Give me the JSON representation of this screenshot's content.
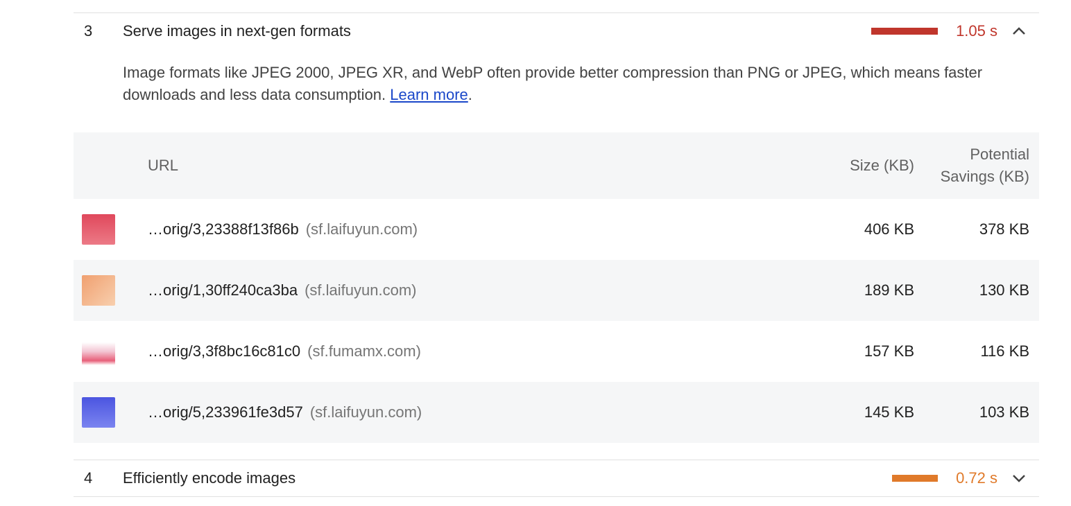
{
  "audits": [
    {
      "index": "3",
      "title": "Serve images in next-gen formats",
      "savings": "1.05 s",
      "savings_fraction": 1.0,
      "color": "#c0362c",
      "expanded": true,
      "description": "Image formats like JPEG 2000, JPEG XR, and WebP often provide better compression than PNG or JPEG, which means faster downloads and less data consumption.",
      "learn_more": "Learn more",
      "period": "."
    },
    {
      "index": "4",
      "title": "Efficiently encode images",
      "savings": "0.72 s",
      "savings_fraction": 0.69,
      "color": "#e07a2a",
      "expanded": false
    }
  ],
  "table": {
    "headers": {
      "url": "URL",
      "size": "Size (KB)",
      "savings_line1": "Potential",
      "savings_line2": "Savings (KB)"
    },
    "rows": [
      {
        "url": "…orig/3,23388f13f86b",
        "host": "(sf.laifuyun.com)",
        "size": "406 KB",
        "savings": "378 KB",
        "thumb_color": "#e35b6b"
      },
      {
        "url": "…orig/1,30ff240ca3ba",
        "host": "(sf.laifuyun.com)",
        "size": "189 KB",
        "savings": "130 KB",
        "thumb_color": "#f4b38a"
      },
      {
        "url": "…orig/3,3f8bc16c81c0",
        "host": "(sf.fumamx.com)",
        "size": "157 KB",
        "savings": "116 KB",
        "thumb_color": "#f6dfe6"
      },
      {
        "url": "…orig/5,233961fe3d57",
        "host": "(sf.laifuyun.com)",
        "size": "145 KB",
        "savings": "103 KB",
        "thumb_color": "#5a63e6"
      }
    ]
  },
  "icons": {
    "collapse": "chevron-up-icon",
    "expand": "chevron-down-icon"
  }
}
